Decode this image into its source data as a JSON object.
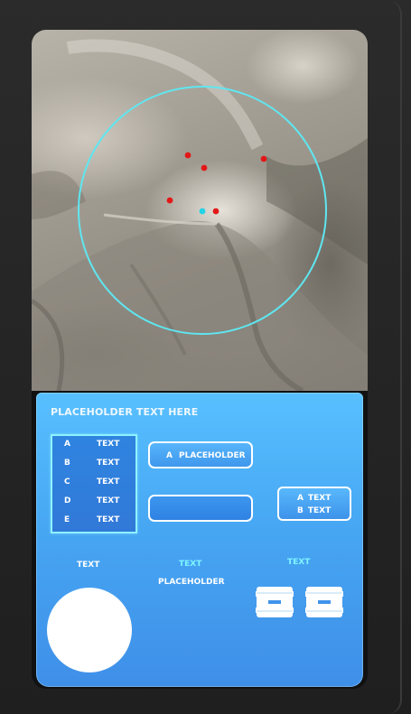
{
  "panel": {
    "title": "PLACEHOLDER TEXT HERE",
    "list": [
      {
        "key": "A",
        "value": "TEXT"
      },
      {
        "key": "B",
        "value": "TEXT"
      },
      {
        "key": "C",
        "value": "TEXT"
      },
      {
        "key": "D",
        "value": "TEXT"
      },
      {
        "key": "E",
        "value": "TEXT"
      }
    ],
    "button_a": {
      "key": "A",
      "label": "PLACEHOLDER"
    },
    "button_ab": [
      {
        "key": "A",
        "value": "TEXT"
      },
      {
        "key": "B",
        "value": "TEXT"
      }
    ],
    "joystick_label": "TEXT",
    "center_label_cyan": "TEXT",
    "center_label_white": "PLACEHOLDER",
    "right_label_cyan": "TEXT"
  },
  "map": {
    "range_ring_color": "#5fe6f0",
    "markers": [
      {
        "type": "hostile",
        "color": "#e21818"
      },
      {
        "type": "hostile",
        "color": "#e21818"
      },
      {
        "type": "hostile",
        "color": "#e21818"
      },
      {
        "type": "hostile",
        "color": "#e21818"
      },
      {
        "type": "hostile",
        "color": "#e21818"
      },
      {
        "type": "self",
        "color": "#22d4e6"
      }
    ]
  },
  "icons": {
    "left_icon_button": "minus-box-icon",
    "right_icon_button": "minus-box-icon"
  },
  "colors": {
    "panel_top": "#58c0ff",
    "panel_bottom": "#3f8fe8",
    "accent_cyan": "#7ff4ff"
  }
}
